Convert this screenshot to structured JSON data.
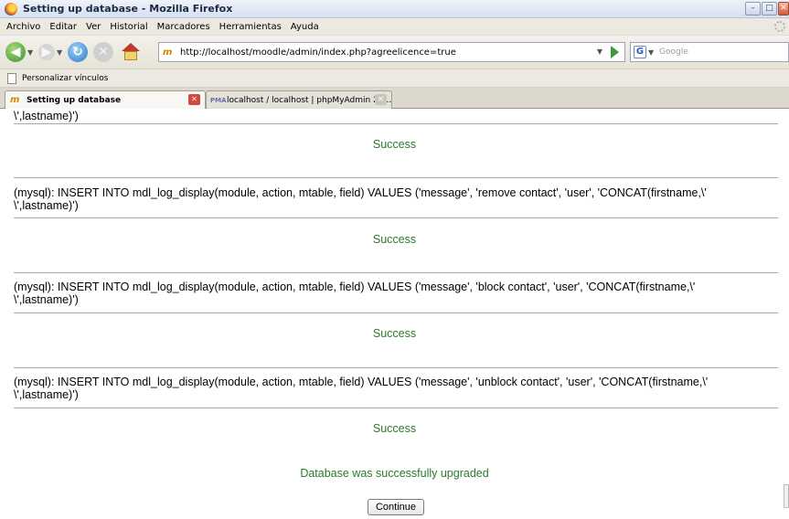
{
  "window": {
    "title": "Setting up database - Mozilla Firefox",
    "buttons": [
      "minimize",
      "maximize",
      "close"
    ]
  },
  "menu": [
    "Archivo",
    "Editar",
    "Ver",
    "Historial",
    "Marcadores",
    "Herramientas",
    "Ayuda"
  ],
  "navigation": {
    "url": "http://localhost/moodle/admin/index.php?agreelicence=true",
    "search_placeholder": "Google",
    "icons": [
      "back-icon",
      "forward-icon",
      "reload-icon",
      "stop-icon",
      "home-icon"
    ]
  },
  "bookmarks": {
    "label": "Personalizar vínculos"
  },
  "tabs": [
    {
      "label": "Setting up database",
      "active": true
    },
    {
      "label": "localhost / localhost | phpMyAdmin 2.1…",
      "active": false
    }
  ],
  "content": {
    "top_fragment": "\\',lastname)')",
    "entries": [
      {
        "sql": "(mysql): INSERT INTO mdl_log_display(module, action, mtable, field) VALUES ('message', 'remove contact', 'user', 'CONCAT(firstname,\\'\n\\',lastname)')"
      },
      {
        "sql": "(mysql): INSERT INTO mdl_log_display(module, action, mtable, field) VALUES ('message', 'block contact', 'user', 'CONCAT(firstname,\\'\n\\',lastname)')"
      },
      {
        "sql": "(mysql): INSERT INTO mdl_log_display(module, action, mtable, field) VALUES ('message', 'unblock contact', 'user', 'CONCAT(firstname,\\'\n\\',lastname)')"
      }
    ],
    "success_label": "Success",
    "final_message": "Database was successfully upgraded",
    "continue_label": "Continue"
  }
}
